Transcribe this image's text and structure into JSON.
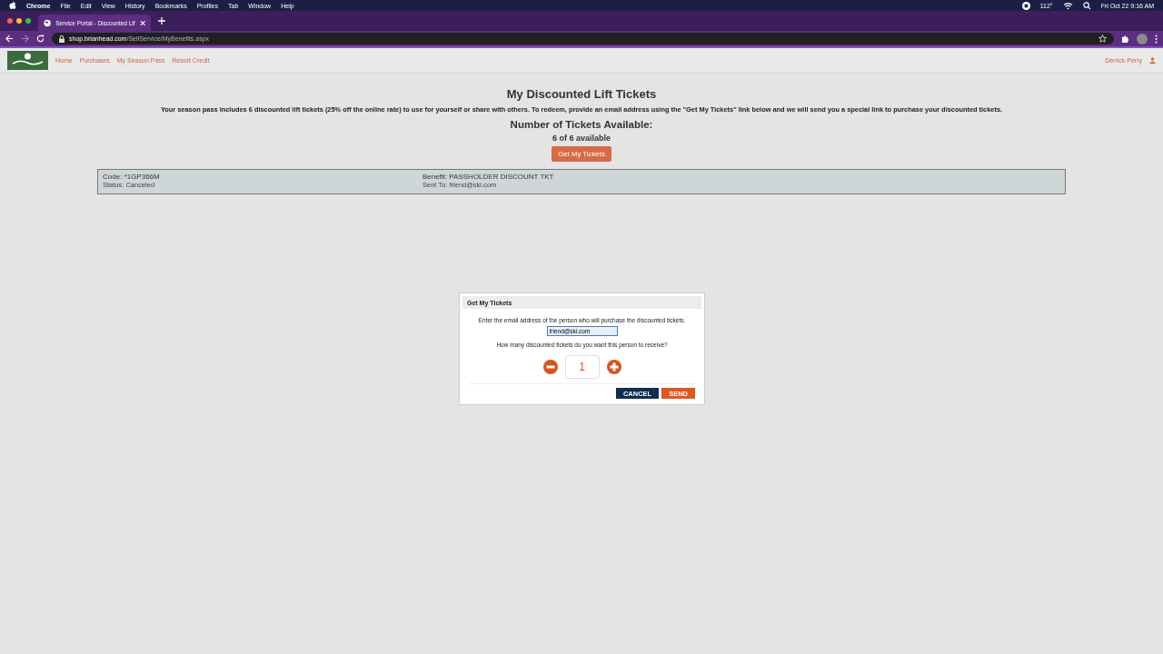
{
  "menubar": {
    "app": "Chrome",
    "menus": [
      "File",
      "Edit",
      "View",
      "History",
      "Bookmarks",
      "Profiles",
      "Tab",
      "Window",
      "Help"
    ],
    "temperature": "112°",
    "clock": "Fri Oct 22  9:16 AM"
  },
  "browser": {
    "tab_title": "Service Portal - Discounted Lif",
    "url_host": "shop.brianhead.com",
    "url_path": "/SelfService/MyBenefits.aspx"
  },
  "site": {
    "nav": [
      "Home",
      "Purchases",
      "My Season Pass",
      "Resort Credit"
    ],
    "user": "Derrick Perry"
  },
  "page": {
    "heading": "My Discounted Lift Tickets",
    "intro": "Your season pass includes 6 discounted lift tickets (25% off the online rate) to use for yourself or share with others. To redeem, provide an email address using the \"Get My Tickets\" link below and we will send you a special link to purchase your discounted tickets.",
    "available_heading": "Number of Tickets Available:",
    "available_count": "6 of 6 available",
    "get_button": "Get My Tickets",
    "benefits": [
      {
        "code": "Code: *1GP366M",
        "status": "Status: Canceled",
        "benefit": "Benefit: PASSHOLDER DISCOUNT TKT",
        "sent_to": "Sent To: friend@ski.com"
      }
    ]
  },
  "dialog": {
    "title": "Get My Tickets",
    "prompt": "Enter the email address of the person who will purchase the discounted tickets.",
    "email": "friend@ski.com",
    "question": "How many discounted tickets do you want this person to receive?",
    "quantity": "1",
    "cancel": "CANCEL",
    "send": "SEND"
  }
}
